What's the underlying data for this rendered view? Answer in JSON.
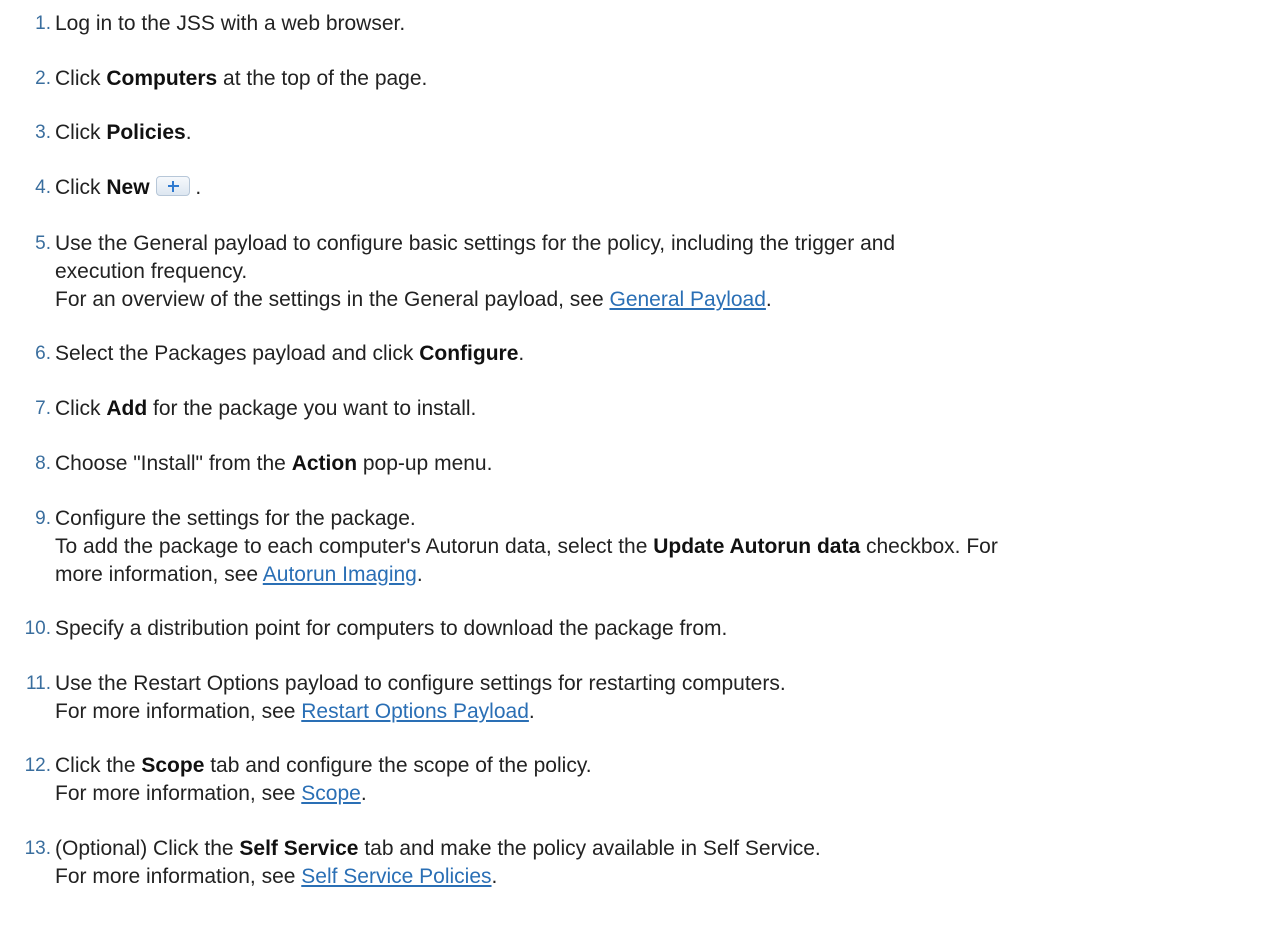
{
  "steps": [
    {
      "num": "1.",
      "pre": "Log in to the JSS with a web browser."
    },
    {
      "num": "2.",
      "pre": "Click ",
      "bold": "Computers",
      "post": " at the top of the page."
    },
    {
      "num": "3.",
      "pre": "Click ",
      "bold": "Policies",
      "post": "."
    },
    {
      "num": "4.",
      "pre": "Click ",
      "bold": "New",
      "post": " .",
      "icon": "add-plus-icon"
    },
    {
      "num": "5.",
      "line1": "Use the General payload to configure basic settings for the policy, including the trigger and",
      "line2": "execution frequency.",
      "line3_pre": "For an overview of the settings in the General payload, see ",
      "link": "General Payload",
      "line3_post": "."
    },
    {
      "num": "6.",
      "pre": "Select the Packages payload and click ",
      "bold": "Configure",
      "post": "."
    },
    {
      "num": "7.",
      "pre": "Click ",
      "bold": "Add",
      "post": " for the package you want to install."
    },
    {
      "num": "8.",
      "pre": "Choose \"Install\" from the ",
      "bold": "Action",
      "post": " pop-up menu."
    },
    {
      "num": "9.",
      "line1": "Configure the settings for the package.",
      "line2_pre": "To add the package to each computer's Autorun data, select the ",
      "line2_bold": "Update Autorun data",
      "line2_post": " checkbox. For",
      "line3_pre": "more information, see ",
      "link": "Autorun Imaging",
      "line3_post": "."
    },
    {
      "num": "10.",
      "pre": "Specify a distribution point for computers to download the package from."
    },
    {
      "num": "11.",
      "line1": "Use the Restart Options payload to configure settings for restarting computers.",
      "line2_pre": "For more information, see ",
      "link": "Restart Options Payload",
      "line2_post": "."
    },
    {
      "num": "12.",
      "pre": "Click the ",
      "bold": "Scope",
      "post": " tab and configure the scope of the policy.",
      "line2_pre": "For more information, see ",
      "link": "Scope",
      "line2_post": "."
    },
    {
      "num": "13.",
      "pre": "(Optional) Click the ",
      "bold": "Self Service",
      "post": " tab and make the policy available in Self Service.",
      "line2_pre": "For more information, see ",
      "link": "Self Service Policies",
      "line2_post": "."
    }
  ],
  "colors": {
    "number": "#3a6e9e",
    "link": "#2a6fb5",
    "text": "#222222"
  }
}
